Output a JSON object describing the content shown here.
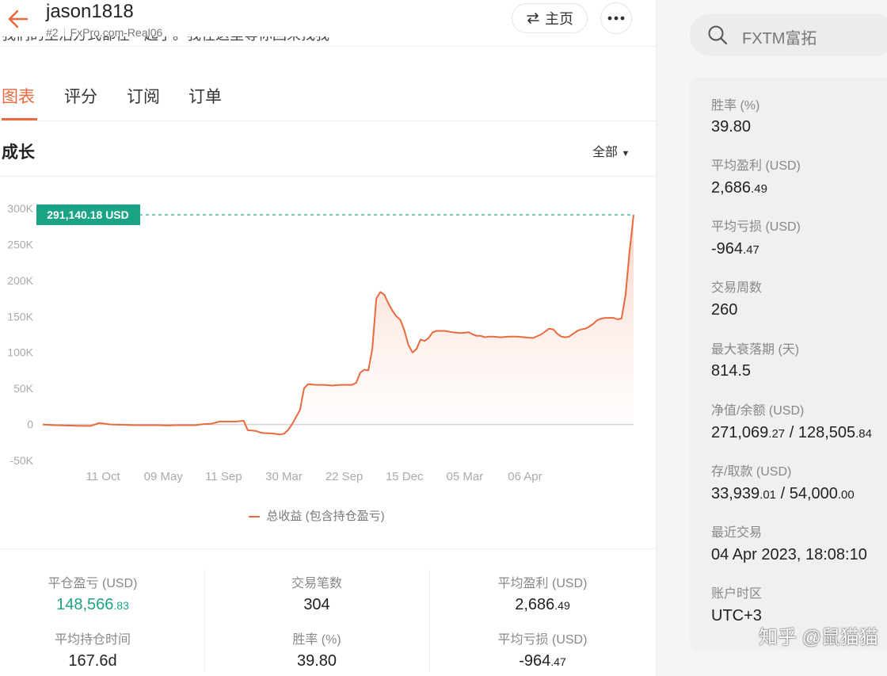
{
  "header": {
    "username": "jason1818",
    "rank": "#2",
    "account": "FxPro.com-Real06",
    "home_label": "主页",
    "cut_text": "我们的生活方式都在一起了。我在这里等你回来找我"
  },
  "tabs": [
    {
      "label": "图表",
      "active": true
    },
    {
      "label": "评分"
    },
    {
      "label": "订阅"
    },
    {
      "label": "订单"
    }
  ],
  "section": {
    "title": "成长",
    "range": "全部"
  },
  "chart_data": {
    "type": "area",
    "series": [
      {
        "name": "总收益 (包含持仓盈亏)",
        "color": "#e86a3e"
      }
    ],
    "y_ticks": [
      "300K",
      "250K",
      "200K",
      "150K",
      "100K",
      "50K",
      "0",
      "-50K"
    ],
    "ylim": [
      -50000,
      300000
    ],
    "x_ticks": [
      "11 Oct",
      "09 May",
      "11 Sep",
      "30 Mar",
      "22 Sep",
      "15 Dec",
      "05 Mar",
      "06 Apr"
    ],
    "last_value_label": "291,140.18 USD",
    "last_value": 291140.18,
    "points": [
      [
        0,
        0
      ],
      [
        3,
        -1000
      ],
      [
        6,
        -1500
      ],
      [
        9,
        -2000
      ],
      [
        12,
        -2000
      ],
      [
        14,
        2000
      ],
      [
        17,
        0
      ],
      [
        20,
        -500
      ],
      [
        23,
        -1000
      ],
      [
        26,
        -1000
      ],
      [
        29,
        -1000
      ],
      [
        31,
        -1500
      ],
      [
        33,
        -1000
      ],
      [
        36,
        -1000
      ],
      [
        38,
        -1000
      ],
      [
        40,
        500
      ],
      [
        42,
        1000
      ],
      [
        44,
        4000
      ],
      [
        46,
        4000
      ],
      [
        48,
        4000
      ],
      [
        50,
        5000
      ],
      [
        51,
        -8000
      ],
      [
        52,
        -8500
      ],
      [
        53,
        -9000
      ],
      [
        54,
        -11000
      ],
      [
        55,
        -12000
      ],
      [
        57,
        -12500
      ],
      [
        59,
        -14000
      ],
      [
        60,
        -13000
      ],
      [
        61,
        -8000
      ],
      [
        62,
        0
      ],
      [
        63,
        10000
      ],
      [
        64,
        20000
      ],
      [
        65,
        50000
      ],
      [
        66,
        56000
      ],
      [
        68,
        55000
      ],
      [
        70,
        55000
      ],
      [
        72,
        54000
      ],
      [
        74,
        55000
      ],
      [
        76,
        55000
      ],
      [
        77,
        55000
      ],
      [
        78,
        58000
      ],
      [
        79,
        72000
      ],
      [
        80,
        76000
      ],
      [
        81,
        75000
      ],
      [
        82,
        105000
      ],
      [
        83,
        175000
      ],
      [
        84,
        184000
      ],
      [
        85,
        180000
      ],
      [
        86,
        168000
      ],
      [
        87,
        158000
      ],
      [
        88,
        150000
      ],
      [
        89,
        145000
      ],
      [
        90,
        130000
      ],
      [
        91,
        110000
      ],
      [
        92,
        100000
      ],
      [
        93,
        105000
      ],
      [
        94,
        118000
      ],
      [
        95,
        116000
      ],
      [
        96,
        120000
      ],
      [
        97,
        128000
      ],
      [
        98,
        130000
      ],
      [
        100,
        130000
      ],
      [
        102,
        128000
      ],
      [
        104,
        127000
      ],
      [
        106,
        128000
      ],
      [
        107,
        125000
      ],
      [
        108,
        123000
      ],
      [
        109,
        123000
      ],
      [
        110,
        121000
      ],
      [
        111,
        122000
      ],
      [
        112,
        122000
      ],
      [
        114,
        121000
      ],
      [
        116,
        122000
      ],
      [
        118,
        122000
      ],
      [
        120,
        121000
      ],
      [
        122,
        120000
      ],
      [
        124,
        125000
      ],
      [
        126,
        133000
      ],
      [
        127,
        132000
      ],
      [
        128,
        126000
      ],
      [
        129,
        122000
      ],
      [
        130,
        121000
      ],
      [
        131,
        122000
      ],
      [
        132,
        126000
      ],
      [
        133,
        130000
      ],
      [
        134,
        132000
      ],
      [
        135,
        133000
      ],
      [
        136,
        136000
      ],
      [
        137,
        140000
      ],
      [
        138,
        145000
      ],
      [
        139,
        147000
      ],
      [
        140,
        148000
      ],
      [
        141,
        148000
      ],
      [
        142,
        148000
      ],
      [
        143,
        146000
      ],
      [
        144,
        147000
      ],
      [
        145,
        180000
      ],
      [
        146,
        240000
      ],
      [
        147,
        291140
      ]
    ],
    "x_tick_positions": [
      15,
      30,
      45,
      60,
      75,
      90,
      105,
      120
    ]
  },
  "stats": [
    {
      "label": "平仓盈亏 (USD)",
      "value": "148,566",
      "decimals": ".83",
      "color": "green"
    },
    {
      "label": "交易笔数",
      "value": "304",
      "decimals": ""
    },
    {
      "label": "平均盈利 (USD)",
      "value": "2,686",
      "decimals": ".49"
    },
    {
      "label": "平均持仓时间",
      "value": "167.6d",
      "decimals": ""
    },
    {
      "label": "胜率 (%)",
      "value": "39.80",
      "decimals": ""
    },
    {
      "label": "平均亏损 (USD)",
      "value": "-964",
      "decimals": ".47"
    }
  ],
  "sidebar": {
    "search_placeholder": "FXTM富拓",
    "metrics": [
      {
        "label": "胜率 (%)",
        "value": "39.80",
        "decimals": ""
      },
      {
        "label": "平均盈利 (USD)",
        "value": "2,686",
        "decimals": ".49"
      },
      {
        "label": "平均亏损 (USD)",
        "value": "-964",
        "decimals": ".47"
      },
      {
        "label": "交易周数",
        "value": "260",
        "decimals": ""
      },
      {
        "label": "最大衰落期 (天)",
        "value": "814.5",
        "decimals": ""
      },
      {
        "label": "净值/余额 (USD)",
        "value": "271,069",
        "decimals": ".27",
        "value2": "128,505",
        "decimals2": ".84"
      },
      {
        "label": "存/取款 (USD)",
        "value": "33,939",
        "decimals": ".01",
        "value2": "54,000",
        "decimals2": ".00"
      },
      {
        "label": "最近交易",
        "value": "04 Apr 2023, 18:08:10",
        "decimals": ""
      },
      {
        "label": "账户时区",
        "value": "UTC+3",
        "decimals": ""
      }
    ]
  },
  "watermark": "知乎 @鼠猫猫"
}
